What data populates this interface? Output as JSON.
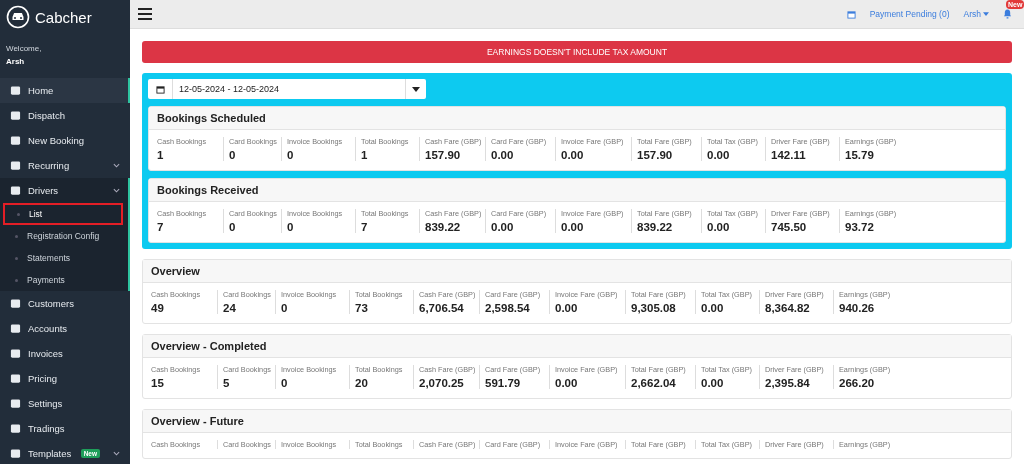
{
  "sidebar": {
    "brand": "Cabcher",
    "welcome": "Welcome,",
    "user": "Arsh",
    "items": [
      {
        "label": "Home",
        "selected": true,
        "expandable": false
      },
      {
        "label": "Dispatch",
        "selected": false,
        "expandable": false
      },
      {
        "label": "New Booking",
        "selected": false,
        "expandable": false
      },
      {
        "label": "Recurring",
        "selected": false,
        "expandable": true,
        "expanded": false
      },
      {
        "label": "Drivers",
        "selected": false,
        "expandable": true,
        "expanded": true,
        "children": [
          {
            "label": "List",
            "selected": true
          },
          {
            "label": "Registration Config",
            "selected": false
          },
          {
            "label": "Statements",
            "selected": false
          },
          {
            "label": "Payments",
            "selected": false
          }
        ]
      },
      {
        "label": "Customers",
        "selected": false,
        "expandable": false
      },
      {
        "label": "Accounts",
        "selected": false,
        "expandable": false
      },
      {
        "label": "Invoices",
        "selected": false,
        "expandable": false
      },
      {
        "label": "Pricing",
        "selected": false,
        "expandable": false
      },
      {
        "label": "Settings",
        "selected": false,
        "expandable": false
      },
      {
        "label": "Tradings",
        "selected": false,
        "expandable": false
      },
      {
        "label": "Templates",
        "selected": false,
        "expandable": true,
        "expanded": false,
        "badge": "New"
      }
    ]
  },
  "topbar": {
    "payment_pending": "Payment Pending (0)",
    "user": "Arsh",
    "notification_badge": "New"
  },
  "alert": "EARNINGS DOESN'T INCLUDE TAX AMOUNT",
  "date_range": {
    "value": "12-05-2024 - 12-05-2024"
  },
  "highlighted_cards": [
    {
      "title": "Bookings Scheduled",
      "stats": [
        {
          "label": "Cash Bookings",
          "value": "1"
        },
        {
          "label": "Card Bookings",
          "value": "0"
        },
        {
          "label": "Invoice Bookings",
          "value": "0"
        },
        {
          "label": "Total Bookings",
          "value": "1"
        },
        {
          "label": "Cash Fare (GBP)",
          "value": "157.90"
        },
        {
          "label": "Card Fare (GBP)",
          "value": "0.00"
        },
        {
          "label": "Invoice Fare (GBP)",
          "value": "0.00"
        },
        {
          "label": "Total Fare (GBP)",
          "value": "157.90"
        },
        {
          "label": "Total Tax (GBP)",
          "value": "0.00"
        },
        {
          "label": "Driver Fare (GBP)",
          "value": "142.11"
        },
        {
          "label": "Earnings (GBP)",
          "value": "15.79"
        }
      ]
    },
    {
      "title": "Bookings Received",
      "stats": [
        {
          "label": "Cash Bookings",
          "value": "7"
        },
        {
          "label": "Card Bookings",
          "value": "0"
        },
        {
          "label": "Invoice Bookings",
          "value": "0"
        },
        {
          "label": "Total Bookings",
          "value": "7"
        },
        {
          "label": "Cash Fare (GBP)",
          "value": "839.22"
        },
        {
          "label": "Card Fare (GBP)",
          "value": "0.00"
        },
        {
          "label": "Invoice Fare (GBP)",
          "value": "0.00"
        },
        {
          "label": "Total Fare (GBP)",
          "value": "839.22"
        },
        {
          "label": "Total Tax (GBP)",
          "value": "0.00"
        },
        {
          "label": "Driver Fare (GBP)",
          "value": "745.50"
        },
        {
          "label": "Earnings (GBP)",
          "value": "93.72"
        }
      ]
    }
  ],
  "cards": [
    {
      "title": "Overview",
      "stats": [
        {
          "label": "Cash Bookings",
          "value": "49"
        },
        {
          "label": "Card Bookings",
          "value": "24"
        },
        {
          "label": "Invoice Bookings",
          "value": "0"
        },
        {
          "label": "Total Bookings",
          "value": "73"
        },
        {
          "label": "Cash Fare (GBP)",
          "value": "6,706.54"
        },
        {
          "label": "Card Fare (GBP)",
          "value": "2,598.54"
        },
        {
          "label": "Invoice Fare (GBP)",
          "value": "0.00"
        },
        {
          "label": "Total Fare (GBP)",
          "value": "9,305.08"
        },
        {
          "label": "Total Tax (GBP)",
          "value": "0.00"
        },
        {
          "label": "Driver Fare (GBP)",
          "value": "8,364.82"
        },
        {
          "label": "Earnings (GBP)",
          "value": "940.26"
        }
      ]
    },
    {
      "title": "Overview - Completed",
      "stats": [
        {
          "label": "Cash Bookings",
          "value": "15"
        },
        {
          "label": "Card Bookings",
          "value": "5"
        },
        {
          "label": "Invoice Bookings",
          "value": "0"
        },
        {
          "label": "Total Bookings",
          "value": "20"
        },
        {
          "label": "Cash Fare (GBP)",
          "value": "2,070.25"
        },
        {
          "label": "Card Fare (GBP)",
          "value": "591.79"
        },
        {
          "label": "Invoice Fare (GBP)",
          "value": "0.00"
        },
        {
          "label": "Total Fare (GBP)",
          "value": "2,662.04"
        },
        {
          "label": "Total Tax (GBP)",
          "value": "0.00"
        },
        {
          "label": "Driver Fare (GBP)",
          "value": "2,395.84"
        },
        {
          "label": "Earnings (GBP)",
          "value": "266.20"
        }
      ]
    },
    {
      "title": "Overview - Future",
      "stats": [
        {
          "label": "Cash Bookings"
        },
        {
          "label": "Card Bookings"
        },
        {
          "label": "Invoice Bookings"
        },
        {
          "label": "Total Bookings"
        },
        {
          "label": "Cash Fare (GBP)"
        },
        {
          "label": "Card Fare (GBP)"
        },
        {
          "label": "Invoice Fare (GBP)"
        },
        {
          "label": "Total Fare (GBP)"
        },
        {
          "label": "Total Tax (GBP)"
        },
        {
          "label": "Driver Fare (GBP)"
        },
        {
          "label": "Earnings (GBP)"
        }
      ]
    }
  ]
}
